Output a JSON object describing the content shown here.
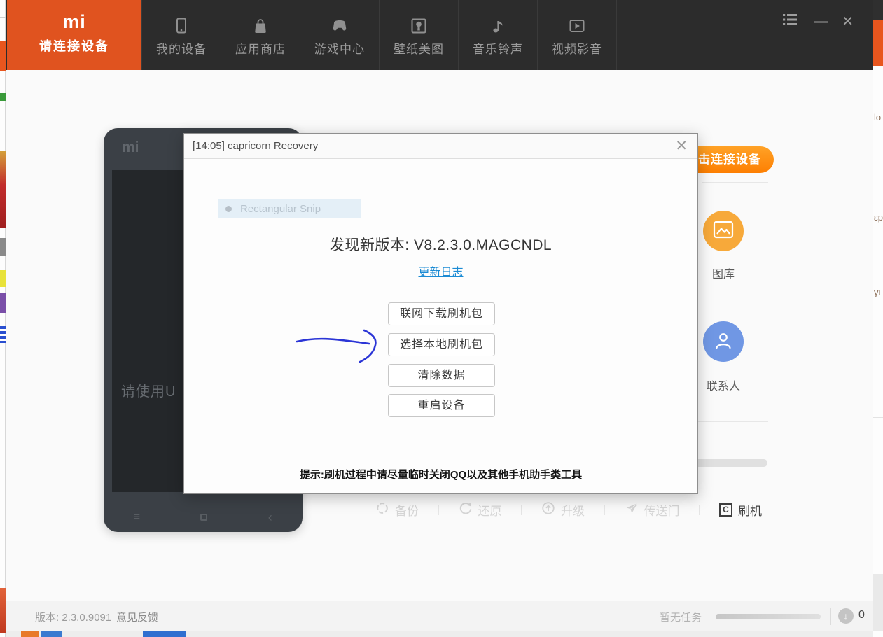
{
  "titlebar": {
    "minimize_glyph": "—",
    "close_glyph": "✕"
  },
  "navbar": {
    "active_tab": {
      "logo": "mi",
      "label": "请连接设备"
    },
    "tabs": [
      {
        "label": "我的设备"
      },
      {
        "label": "应用商店"
      },
      {
        "label": "游戏中心"
      },
      {
        "label": "壁纸美图"
      },
      {
        "label": "音乐铃声"
      },
      {
        "label": "视频影音"
      }
    ]
  },
  "phone": {
    "logo": "mi",
    "screen_text": "请使用U",
    "menu_glyph": "≡",
    "back_glyph": "‹"
  },
  "dialog": {
    "title": "[14:05] capricorn Recovery",
    "close_glyph": "✕",
    "snip_label": "Rectangular Snip",
    "headline": "发现新版本: V8.2.3.0.MAGCNDL",
    "changelog_link": "更新日志",
    "buttons": [
      {
        "label": "联网下载刷机包"
      },
      {
        "label": "选择本地刷机包"
      },
      {
        "label": "清除数据"
      },
      {
        "label": "重启设备"
      }
    ],
    "tip": "提示:刷机过程中请尽量临时关闭QQ以及其他手机助手类工具"
  },
  "right_panel": {
    "connect_button_label": "击连接设备",
    "gallery_label": "图库",
    "contacts_label": "联系人"
  },
  "toolbar": {
    "items": [
      {
        "label": "备份",
        "enabled": false
      },
      {
        "label": "还原",
        "enabled": false
      },
      {
        "label": "升级",
        "enabled": false
      },
      {
        "label": "传送门",
        "enabled": false
      },
      {
        "label": "刷机",
        "enabled": true
      }
    ],
    "flash_icon_letter": "C"
  },
  "statusbar": {
    "version_text": "版本: 2.3.0.9091",
    "feedback_link": "意见反馈",
    "no_task_text": "暂无任务",
    "download_glyph": "↓",
    "download_count": "0"
  },
  "background": {
    "right_edge_texts": [
      {
        "text": "lo"
      },
      {
        "text": "εp"
      },
      {
        "text": "γι"
      }
    ]
  },
  "colors": {
    "nav_bg": "#2c2c2c",
    "accent_orange": "#e0531f",
    "connect_pill_orange": "#ff8d0a",
    "link_blue": "#1b8bd4",
    "gallery_orange": "#f7a93a",
    "contacts_blue": "#7097e4",
    "annotation_arrow_blue": "#2b35d6"
  }
}
